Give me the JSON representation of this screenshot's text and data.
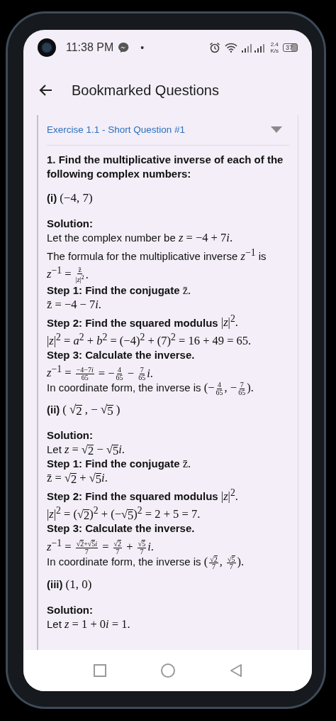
{
  "status_bar": {
    "time": "11:38 PM",
    "dot": "•",
    "speed": "2.4",
    "speed_unit": "K/s",
    "battery": "37"
  },
  "app_bar": {
    "title": "Bookmarked Questions"
  },
  "card": {
    "title": "Exercise 1.1 - Short Question #1",
    "expanded": true,
    "blocks": [
      {
        "kind": "question",
        "parts": [
          {
            "kind": "text",
            "t": "1. Find the multiplicative inverse of each of the following complex numbers:"
          }
        ]
      },
      {
        "kind": "part",
        "parts": [
          {
            "kind": "text",
            "t": "(i)"
          },
          {
            "kind": "math",
            "t": "(−4, 7)"
          }
        ]
      },
      {
        "kind": "solution",
        "parts": [
          {
            "kind": "text",
            "t": "Solution:"
          }
        ]
      },
      {
        "kind": "line",
        "parts": [
          {
            "kind": "text",
            "t": "Let the complex number be "
          },
          {
            "kind": "math",
            "t": "*z* = −4 + 7"
          },
          {
            "kind": "math",
            "t": "*i*."
          }
        ]
      },
      {
        "kind": "line",
        "parts": [
          {
            "kind": "text",
            "t": "The formula for the multiplicative inverse "
          },
          {
            "kind": "math",
            "t": "*z*$^{−1}$"
          },
          {
            "kind": "text",
            "t": " is"
          }
        ]
      },
      {
        "kind": "line",
        "parts": [
          {
            "kind": "math",
            "t": "*z*$^{−1}$ = "
          },
          {
            "kind": "frac",
            "num": [
              {
                "kind": "math",
                "t": "z̄"
              }
            ],
            "den": [
              {
                "kind": "math",
                "t": "|*z*|$^{2}$"
              }
            ]
          },
          {
            "kind": "math",
            "t": "."
          }
        ]
      },
      {
        "kind": "step",
        "parts": [
          {
            "kind": "text",
            "t": "Step 1: Find the conjugate "
          },
          {
            "kind": "math",
            "t": "z̄."
          }
        ]
      },
      {
        "kind": "line",
        "parts": [
          {
            "kind": "math",
            "t": "z̄ = −4 − 7"
          },
          {
            "kind": "math",
            "t": "*i*."
          }
        ]
      },
      {
        "kind": "step",
        "parts": [
          {
            "kind": "text",
            "t": "Step 2: Find the squared modulus "
          },
          {
            "kind": "math",
            "t": "|*z*|$^{2}$."
          }
        ]
      },
      {
        "kind": "line",
        "parts": [
          {
            "kind": "math",
            "t": "|*z*|$^{2}$ = *a*$^{2}$ + *b*$^{2}$ = (−4)$^{2}$ + (7)$^{2}$ = 16 + 49 = 65."
          }
        ]
      },
      {
        "kind": "step",
        "parts": [
          {
            "kind": "text",
            "t": "Step 3: Calculate the inverse."
          }
        ]
      },
      {
        "kind": "line",
        "parts": [
          {
            "kind": "math",
            "t": "*z*$^{−1}$ = "
          },
          {
            "kind": "frac",
            "num": [
              {
                "kind": "math",
                "t": "−4−7"
              },
              {
                "kind": "math",
                "t": "*i*"
              }
            ],
            "den": [
              {
                "kind": "math",
                "t": "65"
              }
            ]
          },
          {
            "kind": "math",
            "t": " = −"
          },
          {
            "kind": "frac",
            "num": [
              {
                "kind": "math",
                "t": "4"
              }
            ],
            "den": [
              {
                "kind": "math",
                "t": "65"
              }
            ]
          },
          {
            "kind": "math",
            "t": " − "
          },
          {
            "kind": "frac",
            "num": [
              {
                "kind": "math",
                "t": "7"
              }
            ],
            "den": [
              {
                "kind": "math",
                "t": "65"
              }
            ]
          },
          {
            "kind": "math",
            "t": "*i*."
          }
        ]
      },
      {
        "kind": "line",
        "parts": [
          {
            "kind": "text",
            "t": "In coordinate form, the inverse is "
          },
          {
            "kind": "math",
            "t": "(−"
          },
          {
            "kind": "frac",
            "num": [
              {
                "kind": "math",
                "t": "4"
              }
            ],
            "den": [
              {
                "kind": "math",
                "t": "65"
              }
            ]
          },
          {
            "kind": "math",
            "t": ", −"
          },
          {
            "kind": "frac",
            "num": [
              {
                "kind": "math",
                "t": "7"
              }
            ],
            "den": [
              {
                "kind": "math",
                "t": "65"
              }
            ]
          },
          {
            "kind": "math",
            "t": ")."
          }
        ]
      },
      {
        "kind": "part",
        "parts": [
          {
            "kind": "text",
            "t": "(ii)"
          },
          {
            "kind": "math",
            "t": "("
          },
          {
            "kind": "sqrt",
            "sign": "√",
            "t": "2"
          },
          {
            "kind": "math",
            "t": ", −"
          },
          {
            "kind": "sqrt",
            "sign": "√",
            "t": "5"
          },
          {
            "kind": "math",
            "t": ")"
          }
        ]
      },
      {
        "kind": "solution",
        "parts": [
          {
            "kind": "text",
            "t": "Solution:"
          }
        ]
      },
      {
        "kind": "line",
        "parts": [
          {
            "kind": "text",
            "t": "Let "
          },
          {
            "kind": "math",
            "t": "*z* = "
          },
          {
            "kind": "sqrt",
            "sign": "√",
            "t": "2"
          },
          {
            "kind": "math",
            "t": " − "
          },
          {
            "kind": "sqrt",
            "sign": "√",
            "t": "5"
          },
          {
            "kind": "math",
            "t": "*i*."
          }
        ]
      },
      {
        "kind": "step",
        "parts": [
          {
            "kind": "text",
            "t": "Step 1: Find the conjugate "
          },
          {
            "kind": "math",
            "t": "z̄."
          }
        ]
      },
      {
        "kind": "line",
        "parts": [
          {
            "kind": "math",
            "t": "z̄ = "
          },
          {
            "kind": "sqrt",
            "sign": "√",
            "t": "2"
          },
          {
            "kind": "math",
            "t": " + "
          },
          {
            "kind": "sqrt",
            "sign": "√",
            "t": "5"
          },
          {
            "kind": "math",
            "t": "*i*."
          }
        ]
      },
      {
        "kind": "step",
        "parts": [
          {
            "kind": "text",
            "t": "Step 2: Find the squared modulus "
          },
          {
            "kind": "math",
            "t": "|*z*|$^{2}$."
          }
        ]
      },
      {
        "kind": "line",
        "parts": [
          {
            "kind": "math",
            "t": "|*z*|$^{2}$ = ("
          },
          {
            "kind": "sqrt",
            "sign": "√",
            "t": "2"
          },
          {
            "kind": "math",
            "t": ")$^{2}$ + (−"
          },
          {
            "kind": "sqrt",
            "sign": "√",
            "t": "5"
          },
          {
            "kind": "math",
            "t": ")$^{2}$ = 2 + 5 = 7."
          }
        ]
      },
      {
        "kind": "step",
        "parts": [
          {
            "kind": "text",
            "t": "Step 3: Calculate the inverse."
          }
        ]
      },
      {
        "kind": "line",
        "parts": [
          {
            "kind": "math",
            "t": "*z*$^{−1}$ = "
          },
          {
            "kind": "frac",
            "num": [
              {
                "kind": "sqrt",
                "sign": "√",
                "t": "2"
              },
              {
                "kind": "math",
                "t": "+"
              },
              {
                "kind": "sqrt",
                "sign": "√",
                "t": "5"
              },
              {
                "kind": "math",
                "t": "*i*"
              }
            ],
            "den": [
              {
                "kind": "math",
                "t": "7"
              }
            ]
          },
          {
            "kind": "math",
            "t": " = "
          },
          {
            "kind": "frac",
            "num": [
              {
                "kind": "sqrt",
                "sign": "√",
                "t": "2"
              }
            ],
            "den": [
              {
                "kind": "math",
                "t": "7"
              }
            ]
          },
          {
            "kind": "math",
            "t": " + "
          },
          {
            "kind": "frac",
            "num": [
              {
                "kind": "sqrt",
                "sign": "√",
                "t": "5"
              }
            ],
            "den": [
              {
                "kind": "math",
                "t": "7"
              }
            ]
          },
          {
            "kind": "math",
            "t": "*i*."
          }
        ]
      },
      {
        "kind": "line",
        "parts": [
          {
            "kind": "text",
            "t": "In coordinate form, the inverse is "
          },
          {
            "kind": "math",
            "t": "("
          },
          {
            "kind": "frac",
            "num": [
              {
                "kind": "sqrt",
                "sign": "√",
                "t": "2"
              }
            ],
            "den": [
              {
                "kind": "math",
                "t": "7"
              }
            ]
          },
          {
            "kind": "math",
            "t": ", "
          },
          {
            "kind": "frac",
            "num": [
              {
                "kind": "sqrt",
                "sign": "√",
                "t": "5"
              }
            ],
            "den": [
              {
                "kind": "math",
                "t": "7"
              }
            ]
          },
          {
            "kind": "math",
            "t": ")."
          }
        ]
      },
      {
        "kind": "part",
        "parts": [
          {
            "kind": "text",
            "t": "(iii)"
          },
          {
            "kind": "math",
            "t": "(1, 0)"
          }
        ]
      },
      {
        "kind": "solution",
        "parts": [
          {
            "kind": "text",
            "t": "Solution:"
          }
        ]
      },
      {
        "kind": "line",
        "parts": [
          {
            "kind": "text",
            "t": "Let "
          },
          {
            "kind": "math",
            "t": "*z* = 1 + 0"
          },
          {
            "kind": "math",
            "t": "*i*"
          },
          {
            "kind": "math",
            "t": " = 1."
          }
        ]
      }
    ]
  }
}
